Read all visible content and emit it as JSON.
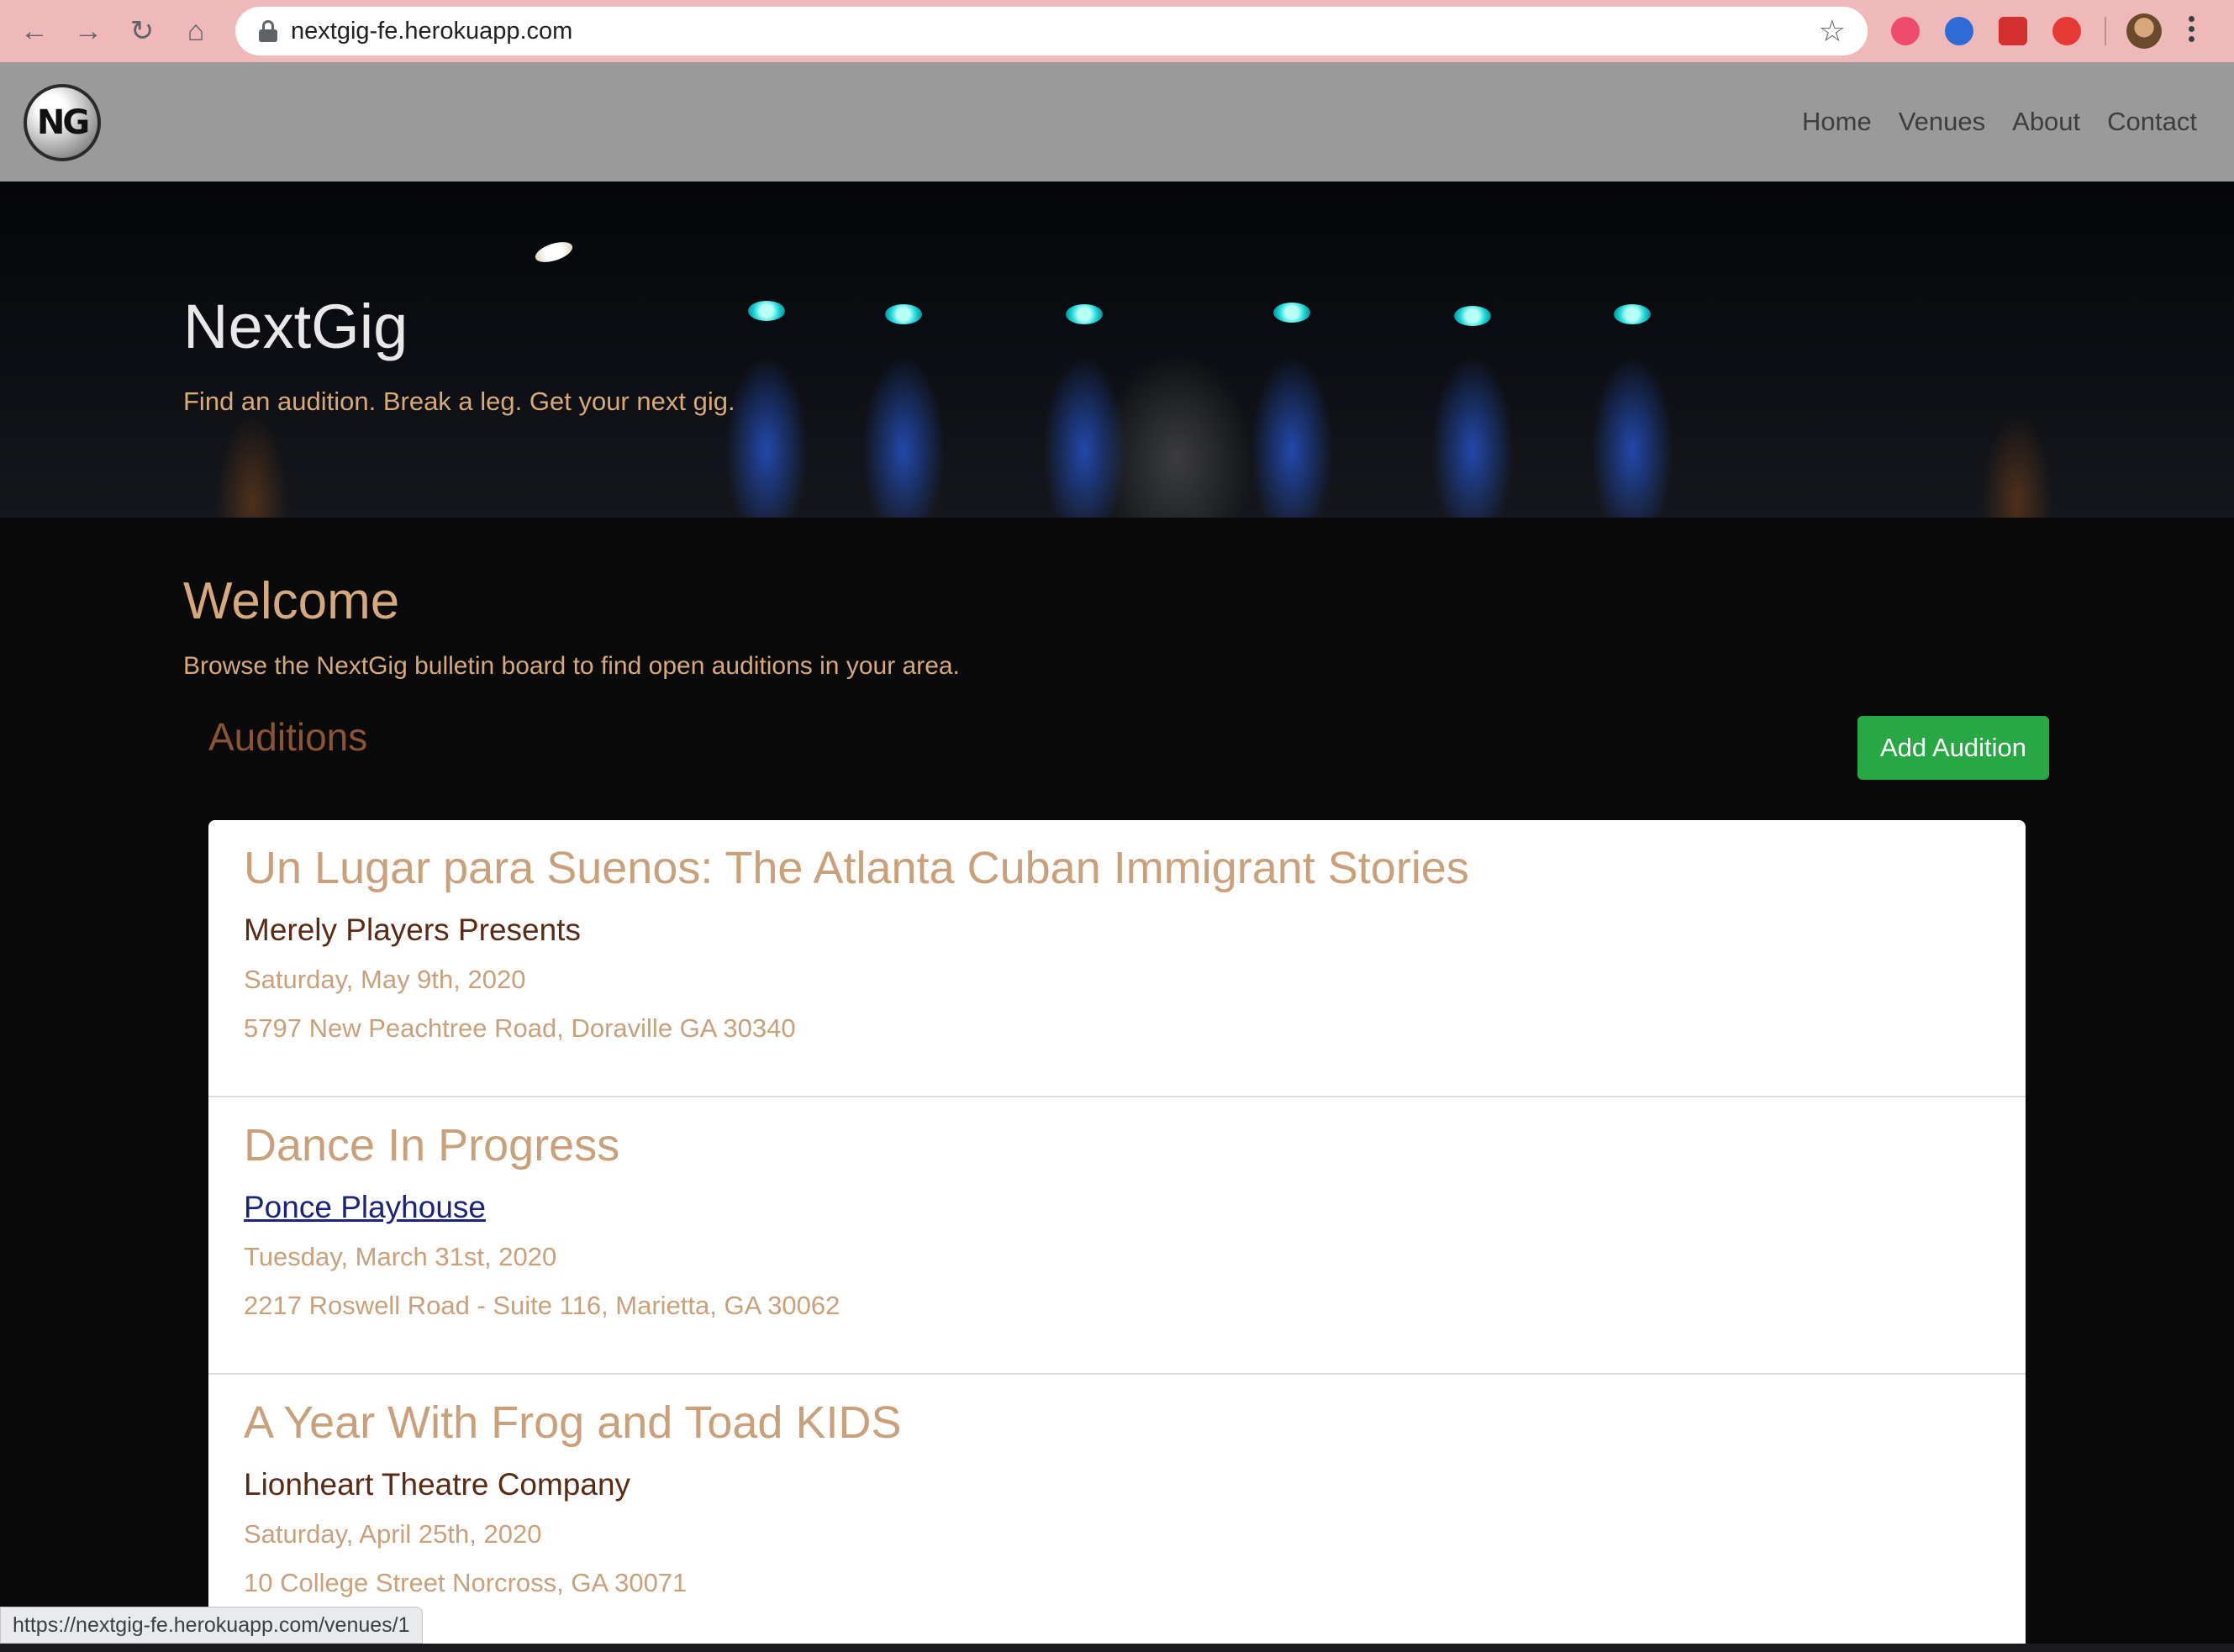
{
  "browser": {
    "url": "nextgig-fe.herokuapp.com",
    "status_url": "https://nextgig-fe.herokuapp.com/venues/1"
  },
  "navbar": {
    "logo_text": "NG",
    "links": [
      "Home",
      "Venues",
      "About",
      "Contact"
    ]
  },
  "hero": {
    "title": "NextGig",
    "tagline": "Find an audition. Break a leg. Get your next gig."
  },
  "welcome": {
    "title": "Welcome",
    "text": "Browse the NextGig bulletin board to find open auditions in your area."
  },
  "auditions": {
    "heading": "Auditions",
    "add_button": "Add Audition",
    "items": [
      {
        "title": "Un Lugar para Suenos: The Atlanta Cuban Immigrant Stories",
        "venue": "Merely Players Presents",
        "date": "Saturday, May 9th, 2020",
        "address": "5797 New Peachtree Road, Doraville GA 30340"
      },
      {
        "title": "Dance In Progress",
        "venue": "Ponce Playhouse",
        "date": "Tuesday, March 31st, 2020",
        "address": "2217 Roswell Road - Suite 116, Marietta, GA 30062"
      },
      {
        "title": "A Year With Frog and Toad KIDS",
        "venue": "Lionheart Theatre Company",
        "date": "Saturday, April 25th, 2020",
        "address": "10 College Street Norcross, GA 30071"
      }
    ]
  },
  "colors": {
    "accent": "#d5a97c",
    "button": "#28a745",
    "navbar": "#9a9a9a",
    "chrome": "#f0b9b9"
  }
}
